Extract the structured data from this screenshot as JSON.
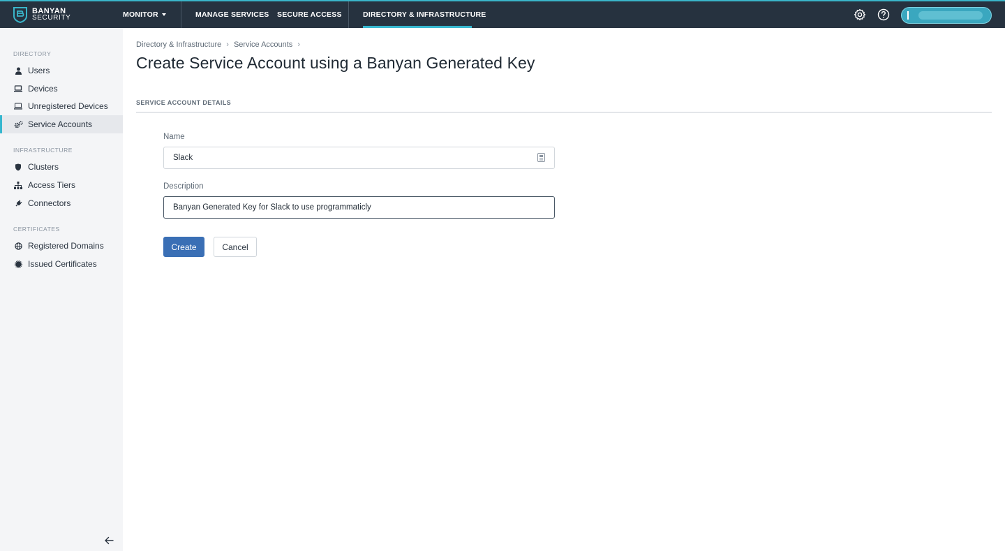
{
  "header": {
    "logo_line1": "BANYAN",
    "logo_line2": "SECURITY",
    "nav": {
      "monitor": "MONITOR",
      "manage_services": "MANAGE SERVICES",
      "secure_access": "SECURE ACCESS",
      "directory_infrastructure": "DIRECTORY & INFRASTRUCTURE"
    },
    "active_nav": "DIRECTORY & INFRASTRUCTURE",
    "icons": [
      "gear-icon",
      "help-icon"
    ],
    "user_initial": "I"
  },
  "sidebar": {
    "sections": [
      {
        "title": "DIRECTORY",
        "items": [
          {
            "label": "Users",
            "icon": "user-icon"
          },
          {
            "label": "Devices",
            "icon": "laptop-icon"
          },
          {
            "label": "Unregistered Devices",
            "icon": "laptop-outline-icon"
          },
          {
            "label": "Service Accounts",
            "icon": "gears-icon",
            "active": true
          }
        ]
      },
      {
        "title": "INFRASTRUCTURE",
        "items": [
          {
            "label": "Clusters",
            "icon": "shield-icon"
          },
          {
            "label": "Access Tiers",
            "icon": "sitemap-icon"
          },
          {
            "label": "Connectors",
            "icon": "plug-icon"
          }
        ]
      },
      {
        "title": "CERTIFICATES",
        "items": [
          {
            "label": "Registered Domains",
            "icon": "globe-icon"
          },
          {
            "label": "Issued Certificates",
            "icon": "certificate-icon"
          }
        ]
      }
    ],
    "collapse_icon": "arrow-left-icon"
  },
  "main": {
    "breadcrumb": [
      "Directory & Infrastructure",
      "Service Accounts"
    ],
    "title": "Create Service Account using a Banyan Generated Key",
    "section_title": "SERVICE ACCOUNT DETAILS",
    "form": {
      "name_label": "Name",
      "name_value": "Slack",
      "description_label": "Description",
      "description_value": "Banyan Generated Key for Slack to use programmaticly"
    },
    "buttons": {
      "create": "Create",
      "cancel": "Cancel"
    }
  },
  "colors": {
    "topbar": "#26323f",
    "accent": "#36b7cf",
    "primary_button": "#3a6fb5",
    "sidebar_bg": "#f4f5f7"
  }
}
